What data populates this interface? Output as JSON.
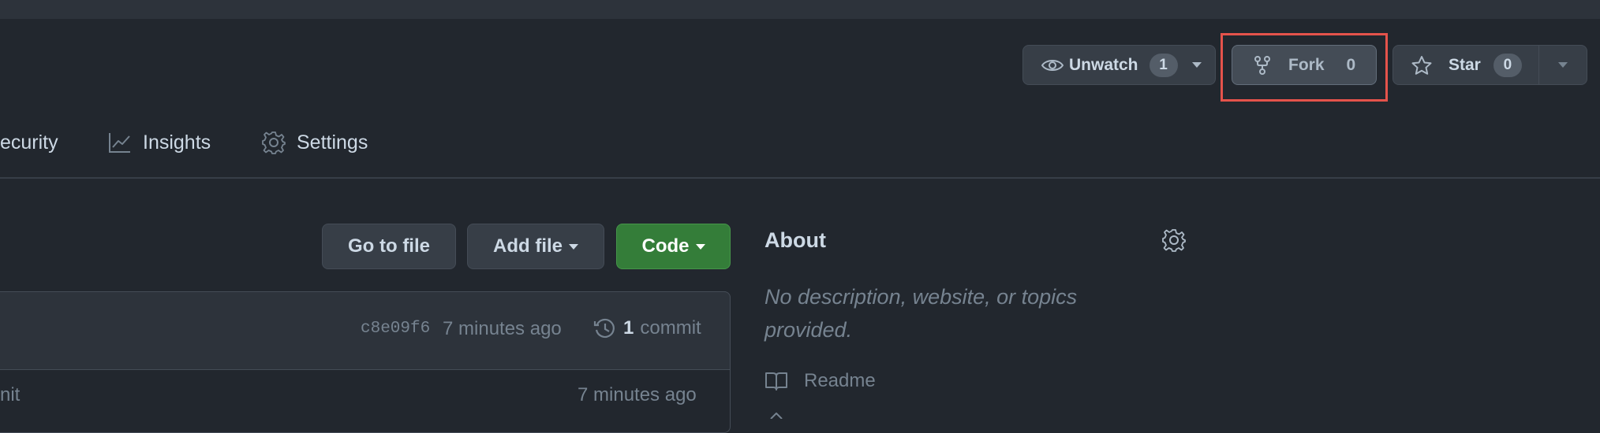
{
  "repo_actions": {
    "unwatch": {
      "label": "Unwatch",
      "count": "1"
    },
    "fork": {
      "label": "Fork",
      "count": "0"
    },
    "star": {
      "label": "Star",
      "count": "0"
    }
  },
  "nav": {
    "tabs": [
      {
        "label": "ecurity",
        "icon": "shield-icon"
      },
      {
        "label": "Insights",
        "icon": "graph-icon"
      },
      {
        "label": "Settings",
        "icon": "gear-icon"
      }
    ]
  },
  "file_toolbar": {
    "go_to_file": "Go to file",
    "add_file": "Add file",
    "code": "Code"
  },
  "commit_bar": {
    "sha": "c8e09f6",
    "time": "7 minutes ago",
    "commit_count": "1",
    "commit_word": "commit"
  },
  "file_rows": [
    {
      "message": "nit",
      "time": "7 minutes ago"
    }
  ],
  "about": {
    "heading": "About",
    "description": "No description, website, or topics provided.",
    "readme": "Readme"
  },
  "colors": {
    "background": "#22272e",
    "code_button": "#347d39",
    "highlight": "#e5534b"
  }
}
